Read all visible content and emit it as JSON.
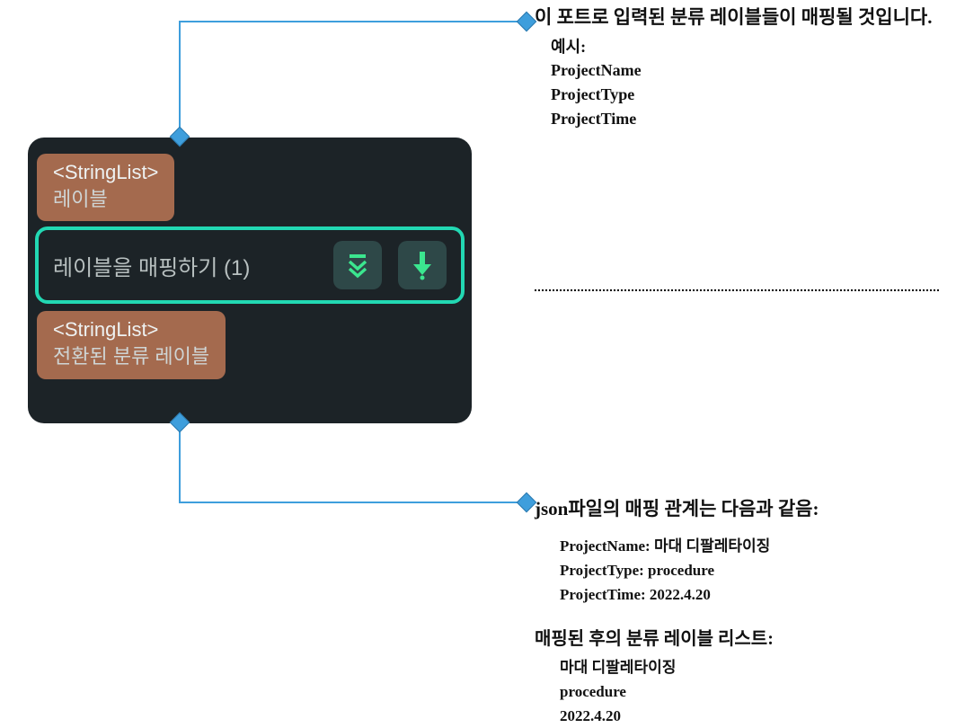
{
  "node": {
    "input_port": {
      "type": "<StringList>",
      "label": "레이블"
    },
    "block": {
      "title": "레이블을 매핑하기 (1)"
    },
    "output_port": {
      "type": "<StringList>",
      "label": "전환된 분류 레이블"
    }
  },
  "annotation_top": {
    "text": "이 포트로 입력된 분류 레이블들이 매핑될 것입니다.",
    "example_label": "예시:",
    "examples": [
      "ProjectName",
      "ProjectType",
      "ProjectTime"
    ]
  },
  "annotation_bottom": {
    "heading": "json파일의 매핑 관계는 다음과 같음:",
    "mappings": [
      {
        "key": "ProjectName:",
        "value": "마대 디팔레타이징"
      },
      {
        "key": "ProjectType:",
        "value": "procedure"
      },
      {
        "key": "ProjectTime:",
        "value": "2022.4.20"
      }
    ],
    "heading2": "매핑된 후의 분류 레이블 리스트:",
    "values": [
      "마대 디팔레타이징",
      "procedure",
      "2022.4.20"
    ]
  }
}
